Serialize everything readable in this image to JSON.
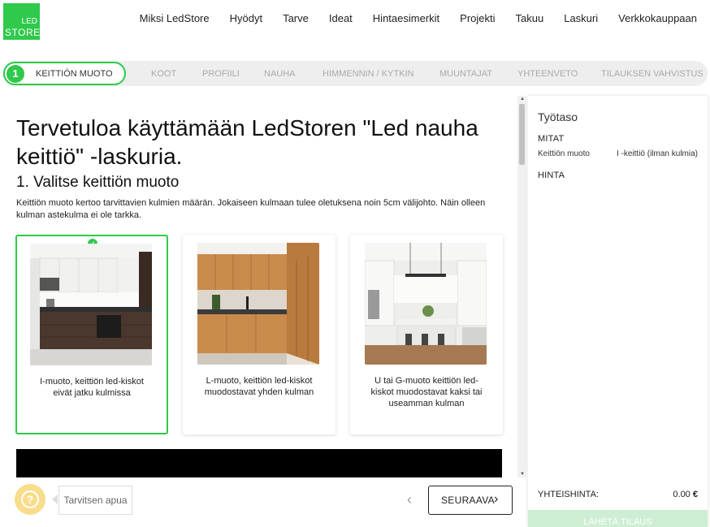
{
  "brand": {
    "logo_line1": "LED",
    "logo_line2": "STORE",
    "accent": "#2fc94c"
  },
  "nav": {
    "items": [
      "Miksi LedStore",
      "Hyödyt",
      "Tarve",
      "Ideat",
      "Hintaesimerkit",
      "Projekti",
      "Takuu",
      "Laskuri",
      "Verkkokauppaan"
    ]
  },
  "steps": {
    "active_number": "1",
    "active_label": "KEITTIÖN MUOTO",
    "items": [
      "KOOT",
      "PROFIILI",
      "NAUHA",
      "HIMMENNIN / KYTKIN",
      "MUUNTAJAT",
      "YHTEENVETO",
      "TILAUKSEN VAHVISTUS"
    ]
  },
  "main": {
    "title": "Tervetuloa käyttämään LedStoren \"Led nauha keittiö\" -laskuria.",
    "section_title": "1. Valitse keittiön muoto",
    "description": "Keittiön muoto kertoo tarvittavien kulmien määrän. Jokaiseen kulmaan tulee oletuksena noin 5cm välijohto. Näin olleen kulman astekulma ei ole tarkka.",
    "options": [
      {
        "caption": "I-muoto, keittiön led-kiskot eivät jatku kulmissa",
        "selected": true
      },
      {
        "caption": "L-muoto, keittiön led-kiskot muodostavat yhden kulman",
        "selected": false
      },
      {
        "caption": "U tai G-muoto keittiön led-kiskot muodostavat kaksi tai useamman kulman",
        "selected": false
      }
    ]
  },
  "panel": {
    "title": "Työtaso",
    "measures_heading": "MITAT",
    "shape_key": "Keittiön muoto",
    "shape_value": "I -keittiö (ilman kulmia)",
    "price_heading": "HINTA",
    "total_label": "YHTEISHINTA:",
    "total_value": "0.00",
    "currency": "€",
    "submit_label": "LÄHETÄ TILAUS"
  },
  "footer": {
    "help_label": "Tarvitsen apua",
    "help_icon": "question-icon",
    "next_label": "SEURAAVA"
  }
}
